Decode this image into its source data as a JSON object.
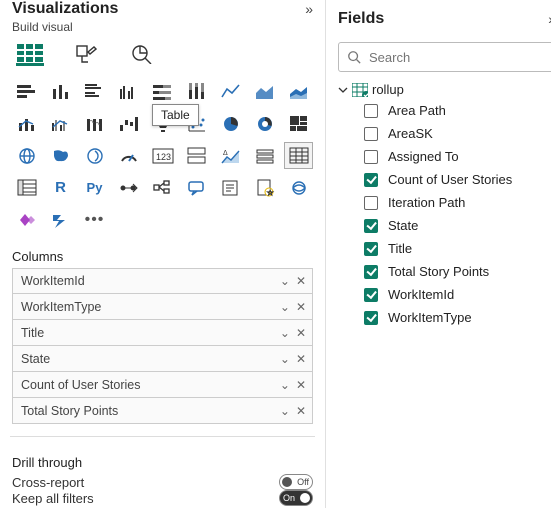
{
  "viz_panel": {
    "title": "Visualizations",
    "sub_title": "Build visual",
    "tooltip": "Table",
    "columns_label": "Columns",
    "column_fields": [
      {
        "label": "WorkItemId"
      },
      {
        "label": "WorkItemType"
      },
      {
        "label": "Title"
      },
      {
        "label": "State"
      },
      {
        "label": "Count of User Stories"
      },
      {
        "label": "Total Story Points"
      }
    ],
    "drill_label": "Drill through",
    "cross_report_label": "Cross-report",
    "cross_report_toggle": "Off",
    "keep_filters_label": "Keep all filters",
    "keep_filters_toggle": "On"
  },
  "fields_panel": {
    "title": "Fields",
    "search_placeholder": "Search",
    "table_name": "rollup",
    "fields": [
      {
        "label": "Area Path",
        "checked": false
      },
      {
        "label": "AreaSK",
        "checked": false
      },
      {
        "label": "Assigned To",
        "checked": false
      },
      {
        "label": "Count of User Stories",
        "checked": true
      },
      {
        "label": "Iteration Path",
        "checked": false
      },
      {
        "label": "State",
        "checked": true
      },
      {
        "label": "Title",
        "checked": true
      },
      {
        "label": "Total Story Points",
        "checked": true
      },
      {
        "label": "WorkItemId",
        "checked": true
      },
      {
        "label": "WorkItemType",
        "checked": true
      }
    ]
  }
}
